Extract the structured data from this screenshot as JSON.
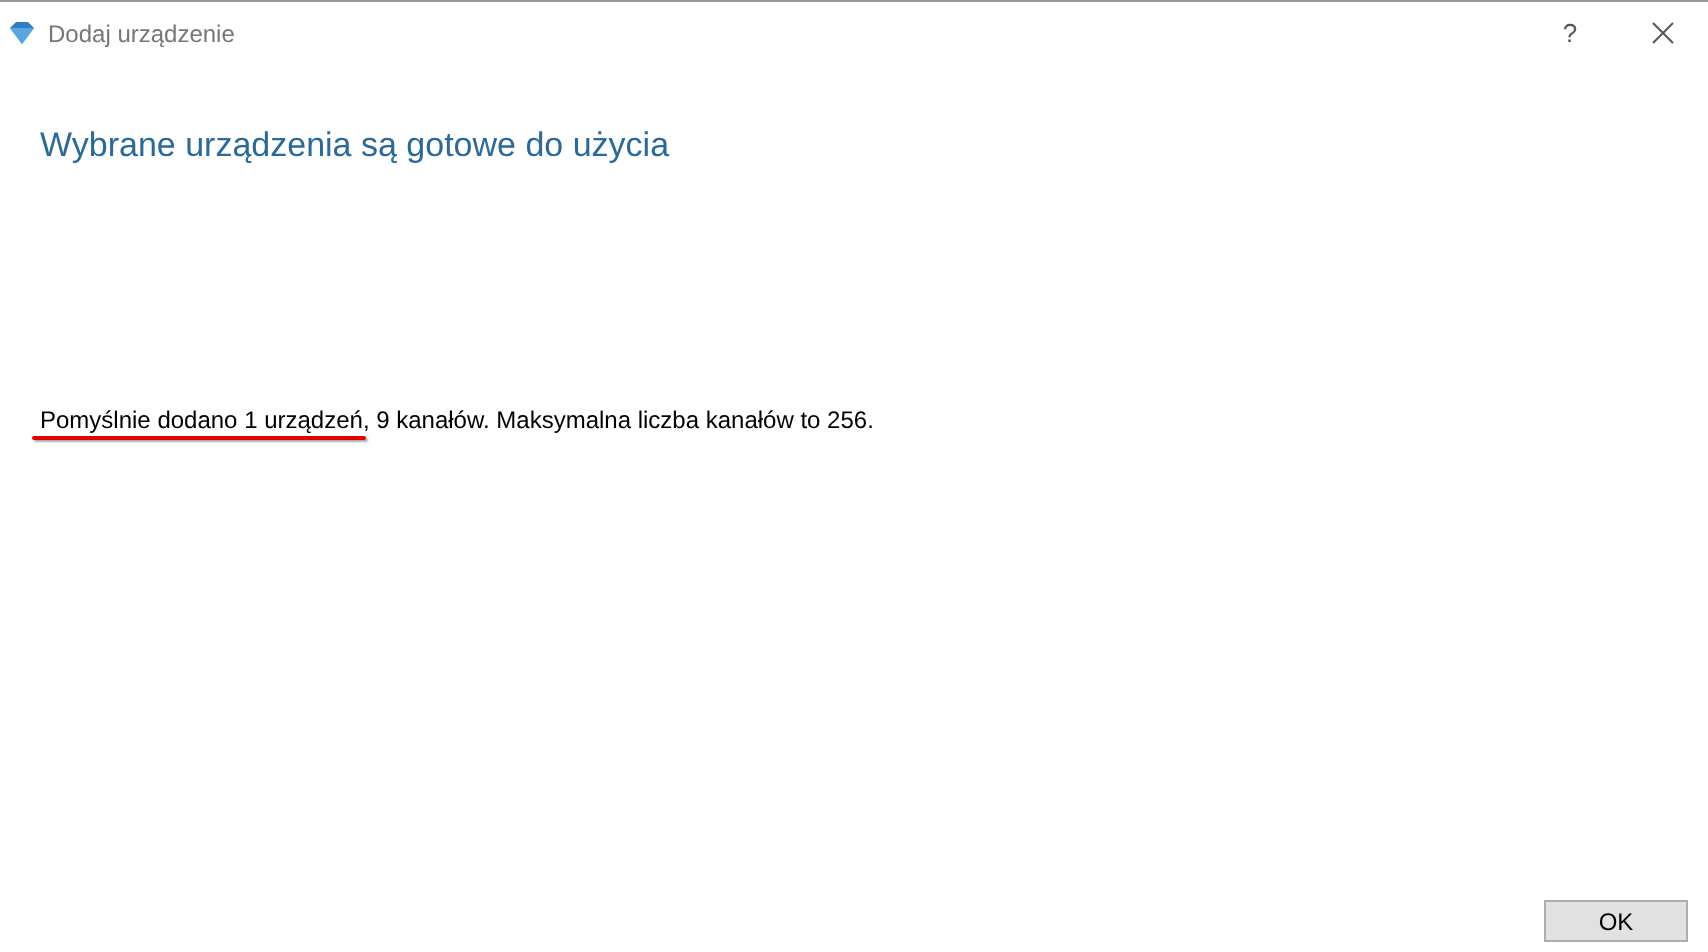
{
  "window": {
    "title": "Dodaj urządzenie",
    "help": "?"
  },
  "heading": "Wybrane urządzenia są gotowe do użycia",
  "message": {
    "underlined": "Pomyślnie dodano 1 urządzeń",
    "rest": ", 9 kanałów. Maksymalna liczba kanałów to 256."
  },
  "buttons": [
    "OK"
  ]
}
